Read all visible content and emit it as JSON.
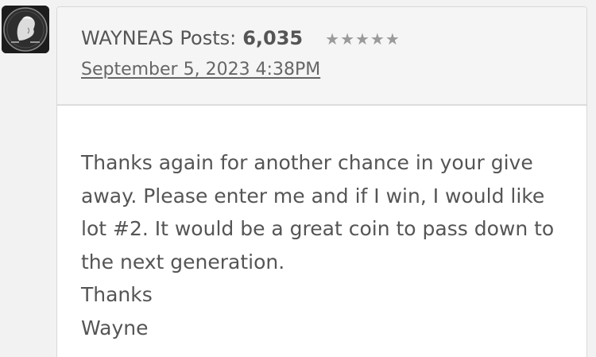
{
  "comment": {
    "author": {
      "username": "WAYNEAS",
      "posts_label": "Posts:",
      "posts_count": "6,035",
      "stars": "★★★★★",
      "avatar_icon": "kennedy-half-dollar-coin-icon"
    },
    "timestamp": "September 5, 2023 4:38PM",
    "body": {
      "paragraph": "Thanks again for another chance in your give away. Please enter me and if I win, I would like lot #2. It would be a great coin to pass down to the next generation.",
      "closing": "Thanks",
      "signature": "Wayne"
    }
  }
}
